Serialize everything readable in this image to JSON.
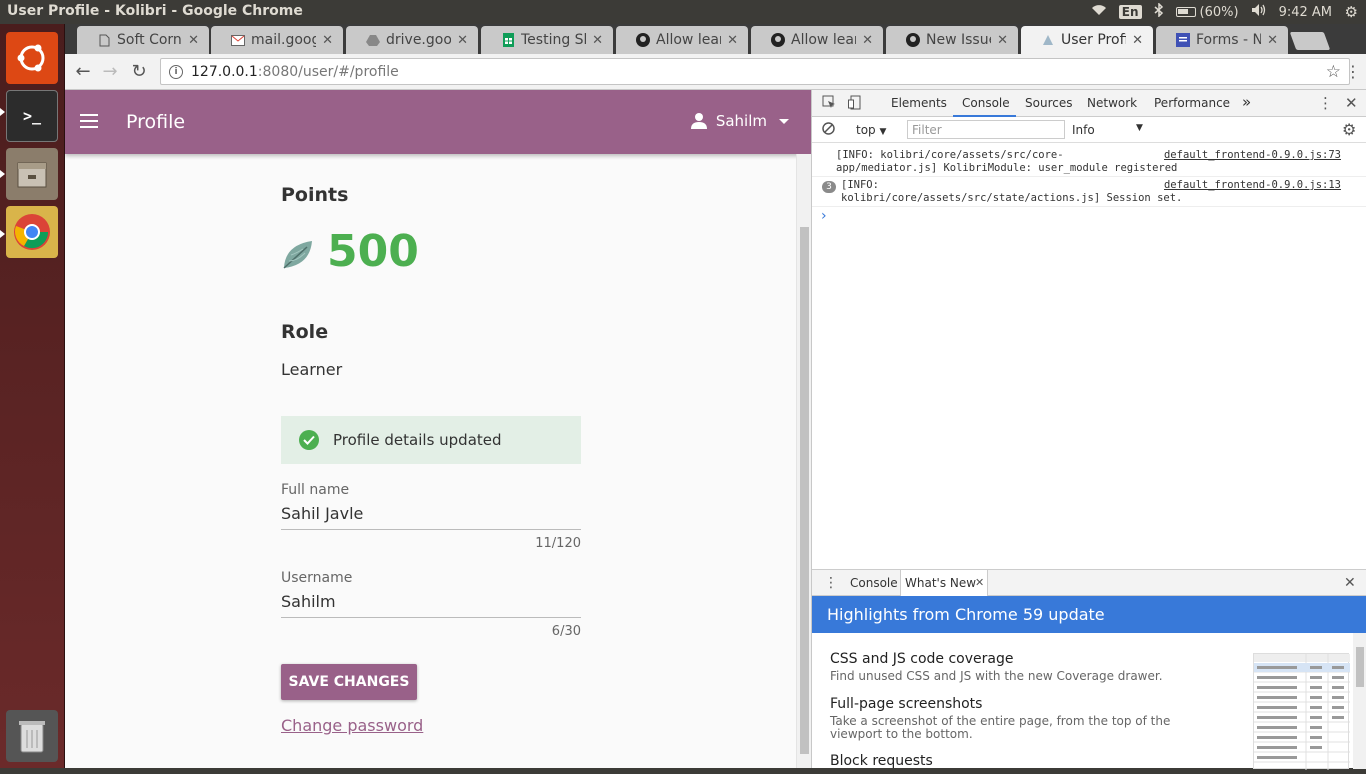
{
  "window": {
    "title": "User Profile - Kolibri - Google Chrome"
  },
  "tray": {
    "lang": "En",
    "battery": "(60%)",
    "time": "9:42 AM"
  },
  "tabs": [
    {
      "label": "Soft Corne",
      "icon": "doc-icon"
    },
    {
      "label": "mail.googl",
      "icon": "gmail-icon"
    },
    {
      "label": "drive.goog",
      "icon": "drive-icon"
    },
    {
      "label": "Testing She",
      "icon": "sheets-icon"
    },
    {
      "label": "Allow learn",
      "icon": "github-icon"
    },
    {
      "label": "Allow learn",
      "icon": "github-icon"
    },
    {
      "label": "New Issue",
      "icon": "github-icon"
    },
    {
      "label": "User Profil",
      "icon": "kolibri-icon"
    },
    {
      "label": "Forms - Na",
      "icon": "forms-icon"
    }
  ],
  "address": {
    "host": "127.0.0.1",
    "path": ":8080/user/#/profile"
  },
  "appbar": {
    "title": "Profile",
    "user": "Sahilm"
  },
  "profile": {
    "points_label": "Points",
    "points_value": "500",
    "role_label": "Role",
    "role_value": "Learner",
    "notice": "Profile details updated",
    "fullname_label": "Full name",
    "fullname_value": "Sahil Javle",
    "fullname_count": "11/120",
    "username_label": "Username",
    "username_value": "Sahilm",
    "username_count": "6/30",
    "save_label": "SAVE CHANGES",
    "change_password": "Change password"
  },
  "devtools": {
    "tabs": [
      "Elements",
      "Console",
      "Sources",
      "Network",
      "Performance"
    ],
    "more": "»",
    "context": "top",
    "filter_placeholder": "Filter",
    "level": "Info",
    "console": [
      {
        "count": "",
        "text1": "[INFO: kolibri/core/assets/src/core-",
        "text2": "app/mediator.js] KolibriModule: user_module registered",
        "src": "default_frontend-0.9.0.js:73"
      },
      {
        "count": "3",
        "text1": "[INFO:",
        "text2": "kolibri/core/assets/src/state/actions.js] Session set.",
        "src": "default_frontend-0.9.0.js:13"
      }
    ],
    "prompt": "›",
    "drawer_tabs": [
      "Console",
      "What's New"
    ],
    "banner": "Highlights from Chrome 59 update",
    "items": [
      {
        "title": "CSS and JS code coverage",
        "desc": "Find unused CSS and JS with the new Coverage drawer."
      },
      {
        "title": "Full-page screenshots",
        "desc": "Take a screenshot of the entire page, from the top of the viewport to the bottom."
      },
      {
        "title": "Block requests",
        "desc": ""
      }
    ]
  }
}
